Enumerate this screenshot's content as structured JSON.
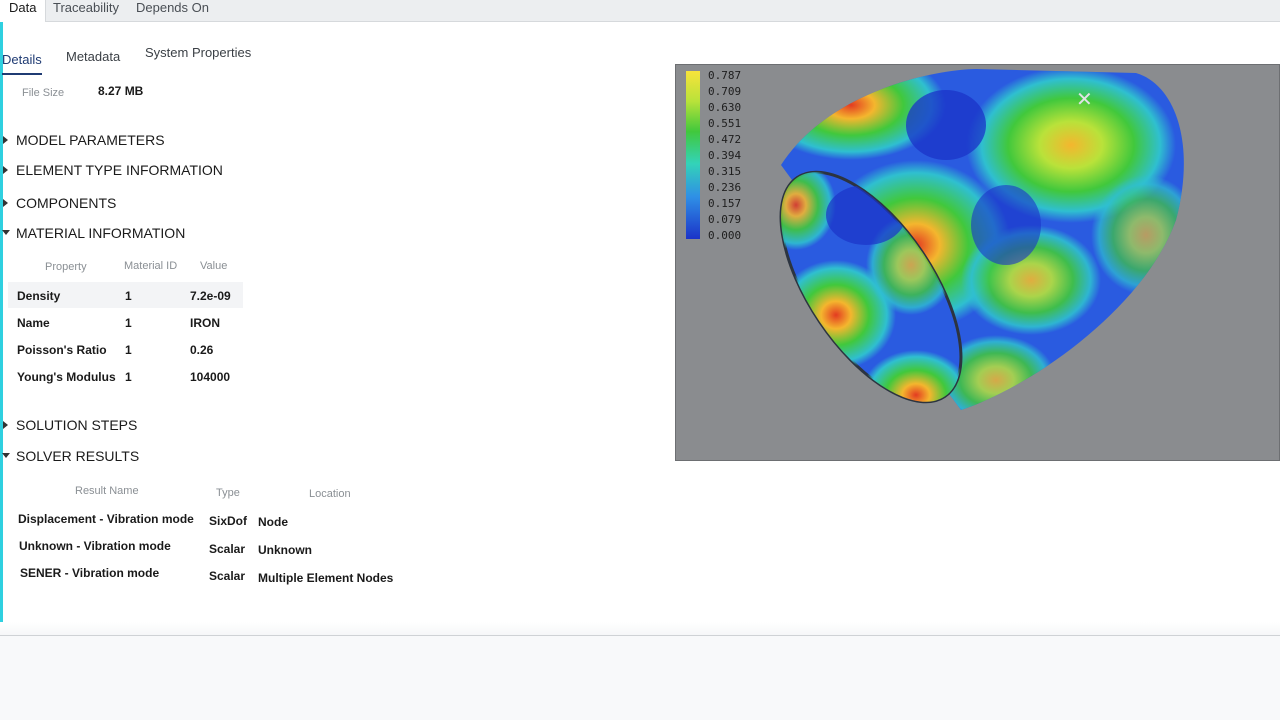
{
  "top_tabs": [
    {
      "label": "Data"
    },
    {
      "label": "Traceability"
    },
    {
      "label": "Depends On"
    }
  ],
  "sub_tabs": [
    {
      "label": "Details"
    },
    {
      "label": "Metadata"
    },
    {
      "label": "System Properties"
    }
  ],
  "file_size": {
    "label": "File Size",
    "value": "8.27 MB"
  },
  "sections": {
    "model_parameters": "MODEL PARAMETERS",
    "element_type_information": "ELEMENT TYPE INFORMATION",
    "components": "COMPONENTS",
    "material_information": "MATERIAL INFORMATION",
    "solution_steps": "SOLUTION STEPS",
    "solver_results": "SOLVER RESULTS"
  },
  "material_table": {
    "headers": [
      "Property",
      "Material ID",
      "Value"
    ],
    "rows": [
      {
        "property": "Density",
        "material_id": "1",
        "value": "7.2e-09"
      },
      {
        "property": "Name",
        "material_id": "1",
        "value": "IRON"
      },
      {
        "property": "Poisson's Ratio",
        "material_id": "1",
        "value": "0.26"
      },
      {
        "property": "Young's Modulus",
        "material_id": "1",
        "value": "104000"
      }
    ]
  },
  "results_table": {
    "headers": [
      "Result Name",
      "Type",
      "Location"
    ],
    "rows": [
      {
        "name": "Displacement - Vibration mode",
        "type": "SixDof",
        "location": "Node"
      },
      {
        "name": "Unknown - Vibration mode",
        "type": "Scalar",
        "location": "Unknown"
      },
      {
        "name": "SENER - Vibration mode",
        "type": "Scalar",
        "location": "Multiple Element Nodes"
      }
    ]
  },
  "viewer": {
    "legend": [
      "0.787",
      "0.709",
      "0.630",
      "0.551",
      "0.472",
      "0.394",
      "0.315",
      "0.236",
      "0.157",
      "0.079",
      "0.000"
    ],
    "colors": {
      "high": "#f7e33b",
      "mid": "#41c83c",
      "low": "#1b33c8",
      "background": "#8a8c8f"
    }
  },
  "colors": {
    "accent": "#1f3b73",
    "edge": "#2fd0e0"
  }
}
